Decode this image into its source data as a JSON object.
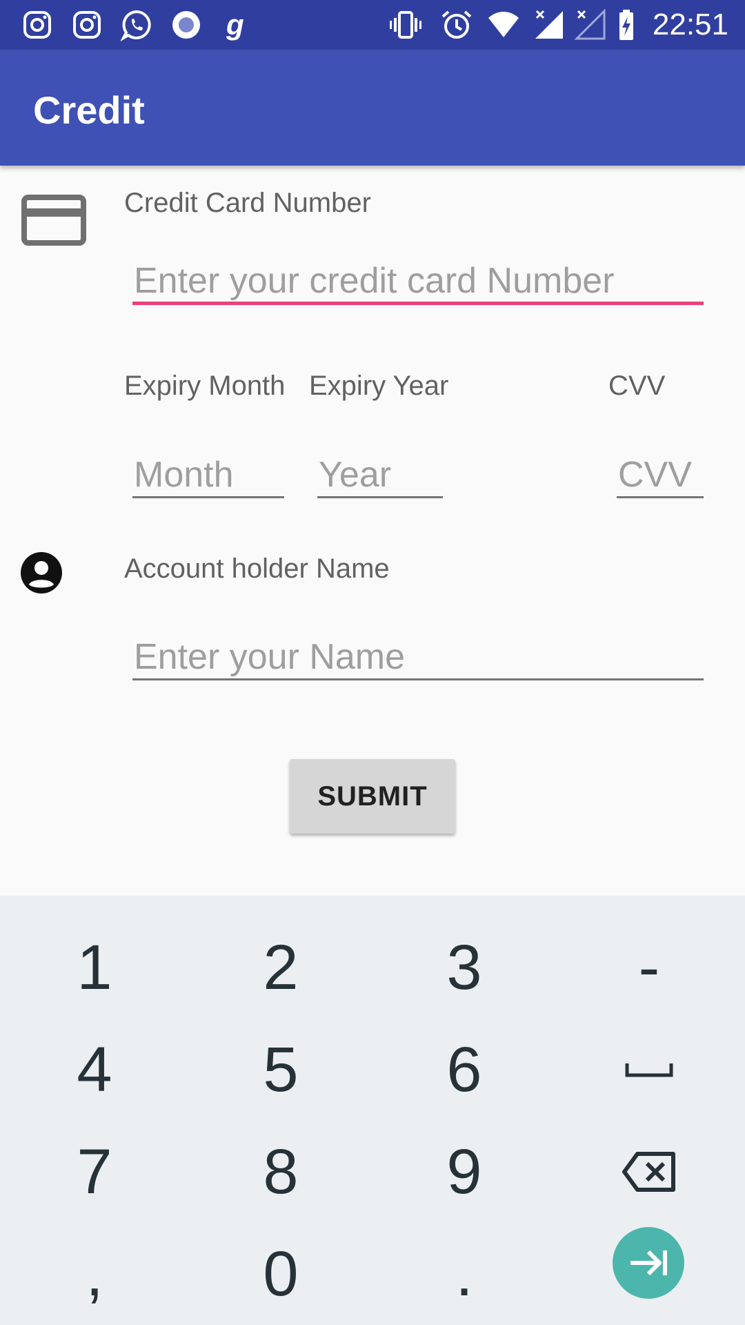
{
  "status_bar": {
    "time": "22:51",
    "left_icons": [
      "instagram-icon",
      "instagram-icon",
      "whatsapp-icon",
      "media-icon",
      "g-icon"
    ],
    "right_icons": [
      "vibrate-icon",
      "alarm-icon",
      "wifi-icon",
      "signal-icon",
      "signal-off-icon",
      "battery-charging-icon"
    ]
  },
  "app_bar": {
    "title": "Credit",
    "color": "#3f51b5"
  },
  "form": {
    "card_number": {
      "label": "Credit Card Number",
      "placeholder": "Enter your credit card Number",
      "value": "",
      "focused": true
    },
    "expiry_month": {
      "label": "Expiry Month",
      "placeholder": "Month",
      "value": ""
    },
    "expiry_year": {
      "label": "Expiry Year",
      "placeholder": "Year",
      "value": ""
    },
    "cvv": {
      "label": "CVV",
      "placeholder": "CVV",
      "value": ""
    },
    "holder_name": {
      "label": "Account holder Name",
      "placeholder": "Enter your Name",
      "value": ""
    },
    "submit_label": "SUBMIT",
    "accent_color": "#ec407a"
  },
  "keyboard": {
    "rows": [
      [
        "1",
        "2",
        "3",
        "-"
      ],
      [
        "4",
        "5",
        "6",
        "space-icon"
      ],
      [
        "7",
        "8",
        "9",
        "backspace-icon"
      ],
      [
        ",",
        "0",
        ".",
        "next-icon"
      ]
    ],
    "action_color": "#4db6ac"
  }
}
